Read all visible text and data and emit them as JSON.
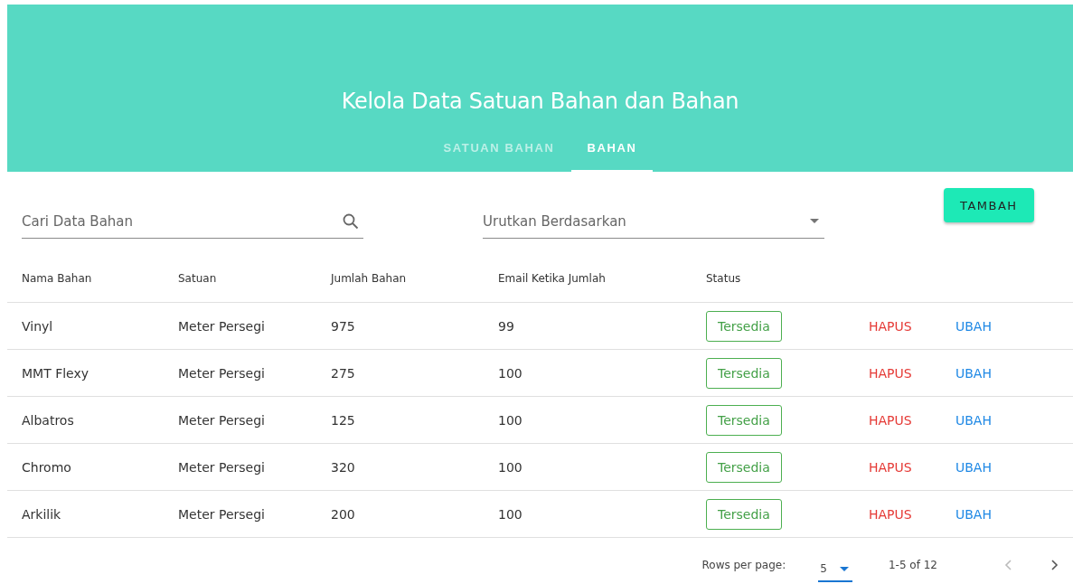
{
  "header": {
    "title": "Kelola Data Satuan Bahan dan Bahan"
  },
  "tabs": [
    {
      "label": "SATUAN BAHAN",
      "selected": false
    },
    {
      "label": "BAHAN",
      "selected": true
    }
  ],
  "search": {
    "placeholder": "Cari Data Bahan"
  },
  "sort": {
    "placeholder": "Urutkan Berdasarkan"
  },
  "add_button": "TAMBAH",
  "table": {
    "columns": [
      "Nama Bahan",
      "Satuan",
      "Jumlah Bahan",
      "Email Ketika Jumlah",
      "Status"
    ],
    "rows": [
      {
        "cells": [
          "Vinyl",
          "Meter Persegi",
          "975",
          "99"
        ],
        "status": "Tersedia",
        "actions": [
          "HAPUS",
          "UBAH"
        ]
      },
      {
        "cells": [
          "MMT Flexy",
          "Meter Persegi",
          "275",
          "100"
        ],
        "status": "Tersedia",
        "actions": [
          "HAPUS",
          "UBAH"
        ]
      },
      {
        "cells": [
          "Albatros",
          "Meter Persegi",
          "125",
          "100"
        ],
        "status": "Tersedia",
        "actions": [
          "HAPUS",
          "UBAH"
        ]
      },
      {
        "cells": [
          "Chromo",
          "Meter Persegi",
          "320",
          "100"
        ],
        "status": "Tersedia",
        "actions": [
          "HAPUS",
          "UBAH"
        ]
      },
      {
        "cells": [
          "Arkilik",
          "Meter Persegi",
          "200",
          "100"
        ],
        "status": "Tersedia",
        "actions": [
          "HAPUS",
          "UBAH"
        ]
      }
    ]
  },
  "pagination": {
    "rows_per_page_label": "Rows per page:",
    "rows_per_page": "5",
    "range": "1-5 of 12",
    "prev_disabled": true,
    "next_disabled": false
  }
}
